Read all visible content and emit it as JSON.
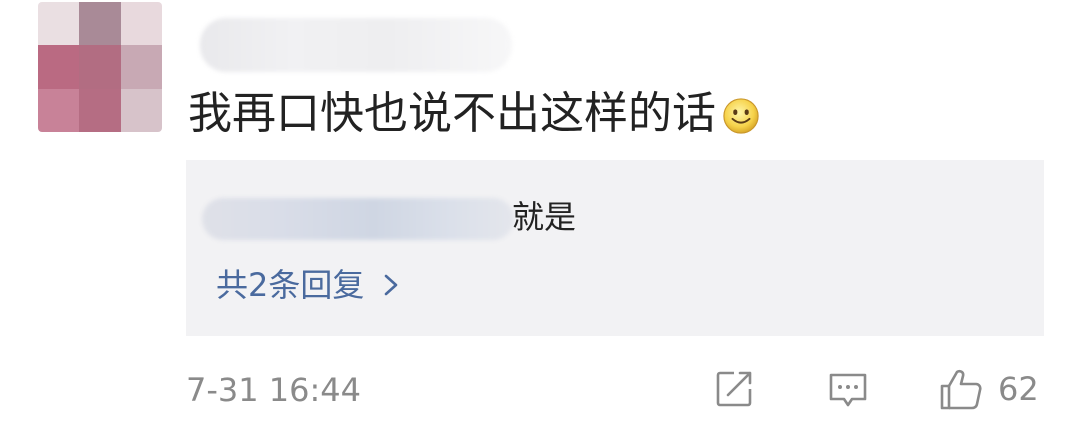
{
  "comment": {
    "text": "我再口快也说不出这样的话",
    "emoji": "smiley-face"
  },
  "reply_preview": {
    "text": "就是",
    "view_replies_label": "共2条回复"
  },
  "footer": {
    "timestamp": "7-31 16:44",
    "like_count": "62",
    "icons": [
      "share-icon",
      "comment-icon",
      "thumbs-up-icon"
    ]
  },
  "colors": {
    "link": "#4a6a9e",
    "meta_gray": "#8a8a8a",
    "reply_bg": "#f2f2f4"
  }
}
